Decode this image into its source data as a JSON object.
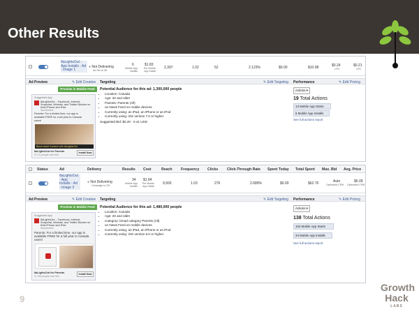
{
  "slide": {
    "title": "Other Results",
    "page_number": "9",
    "brand": {
      "line1": "Growth",
      "line2": "Hack",
      "line3": "LABS"
    }
  },
  "panel1": {
    "row": {
      "ad_name": "8aLightsOut - App Installs - Ad - Image 1",
      "delivery": "Not Delivering",
      "delivery_sub": "Ad Set Is Off",
      "results": "6",
      "results_sub": "Mobile App Installs",
      "cost": "$1.83",
      "cost_sub": "Per Mobile App Install",
      "reach": "2,397",
      "frequency": "1.02",
      "clicks": "52",
      "ctr": "2.123%",
      "spent_today": "$0.00",
      "total_spent": "$10.98",
      "max_bid": "$0.24",
      "max_bid_sub": "CPC",
      "avg_price": "$0.21",
      "avg_price_sub": "CPC"
    },
    "sections": {
      "ad_preview": "Ad Preview",
      "edit_creative": "✎ Edit Creative",
      "targeting": "Targeting",
      "edit_targeting": "✎ Edit Targeting",
      "performance": "Performance",
      "edit_pricing": "✎ Edit Pricing"
    },
    "preview": {
      "button": "Preview in Mobile Feed",
      "suggested": "Suggested App",
      "app_name": "8aLightsOut – Facebook, Internet,",
      "app_name2": "Snapchat, Website, and Twitter Blocker on",
      "app_name3": "Kids iPhone and iPad",
      "sponsored": "Sponsored",
      "body1": "Parents: For a limited time, our app is",
      "body2": "available FREE for a full year to Canada",
      "body3": "users!",
      "bar": "Block Adult Content with 8aLightsOut",
      "footer1": "8aLightsOut for Parents",
      "footer2": "3,7 6 people use this",
      "install": "Install Now"
    },
    "targeting": {
      "title": "Potential Audience for this ad: 1,300,000 people",
      "items": [
        "Location: Canada",
        "Age: 20 and older",
        "Parents: Parents (All)",
        "on News Feed on mobile devices",
        "Currently using: an iPad, an iPhone or an iPod",
        "Currently using: iOS version 7.0 or higher"
      ],
      "suggested_bid": "Suggested Bid: $0.20 - 0.41 USD"
    },
    "performance": {
      "dropdown": "Actions ▾",
      "total_num": "19",
      "total_label": "Total Actions",
      "items": [
        "13 Mobile App Starts",
        "6 Mobile App Installs"
      ],
      "see_full": "See full actions report"
    }
  },
  "panel2": {
    "headers": {
      "status": "Status",
      "ad": "Ad",
      "delivery": "Delivery",
      "results": "Results",
      "cost": "Cost",
      "reach": "Reach",
      "frequency": "Frequency",
      "clicks": "Clicks",
      "ctr": "Click-Through Rate",
      "spent_today": "Spent Today",
      "total_spent": "Total Spent",
      "max_bid": "Max. Bid",
      "avg_price": "Avg. Price"
    },
    "row": {
      "ad_name_1": "8aLightsOut",
      "ad_name_2": "- App",
      "ad_name_3": "Installs - Ad",
      "ad_name_4": "- Image 3",
      "delivery": "Not Delivering",
      "delivery_sub": "Campaign is Off",
      "results": "34",
      "results_sub": "Mobile App Installs",
      "cost": "$1.84",
      "cost_sub": "Per Mobile App Install",
      "reach": "9,993",
      "frequency": "1.03",
      "clicks": "276",
      "ctr": "2.689%",
      "spent_today": "$0.00",
      "total_spent": "$62.76",
      "max_bid": "Auto",
      "max_bid_sub": "Optimized CPM",
      "avg_price": "$6.09",
      "avg_price_sub": "Optimized CPM"
    },
    "sections": {
      "ad_preview": "Ad Preview",
      "edit_creative": "✎ Edit Creative",
      "targeting": "Targeting",
      "edit_targeting": "✎ Edit Targeting",
      "performance": "Performance",
      "edit_pricing": "✎ Edit Pricing"
    },
    "preview": {
      "button": "Preview in Mobile Feed",
      "suggested": "Suggested App",
      "app_name": "8aLightsOut – Facebook, Internet,",
      "app_name2": "Snapchat, Website, and Twitter Blocker on",
      "app_name3": "Kids iPhone and iPad",
      "sponsored": "Sponsored",
      "body1": "Parents: For a limited time, our app is",
      "body2": "available FREE for a full year to Canada",
      "body3": "users!",
      "footer1": "8aLightsOut for Parents",
      "footer2": "3,718 people use this",
      "install": "Install Now"
    },
    "targeting": {
      "title": "Potential Audience for this ad: 1,480,000 people",
      "items": [
        "Location: Canada",
        "Age: 20 and older",
        "Category: broad category Parents (All)",
        "on News Feed on mobile devices",
        "Currently using: an iPad, an iPhone or an iPod",
        "Currently using: iOS version 5.0 or higher"
      ]
    },
    "performance": {
      "dropdown": "Actions ▾",
      "total_num": "138",
      "total_label": "Total Actions",
      "items": [
        "104 Mobile App Starts",
        "34 Mobile App Installs"
      ],
      "see_full": "See full actions report"
    }
  },
  "colors": {
    "header_bg": "#3b3631",
    "accent_green": "#8cc63f",
    "fb_blue": "#3b5998",
    "btn_green": "#5ba64a"
  }
}
